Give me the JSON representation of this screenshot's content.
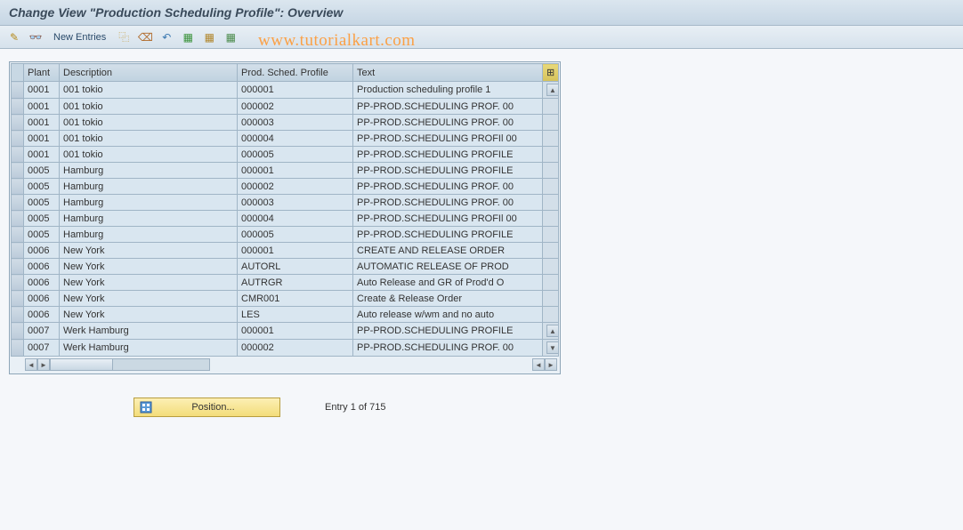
{
  "title": "Change View \"Production Scheduling Profile\": Overview",
  "watermark": "www.tutorialkart.com",
  "toolbar": {
    "new_entries_label": "New Entries"
  },
  "columns": {
    "plant": "Plant",
    "description": "Description",
    "profile": "Prod. Sched. Profile",
    "text": "Text"
  },
  "rows": [
    {
      "plant": "0001",
      "description": "001 tokio",
      "profile": "000001",
      "text": "Production scheduling profile 1"
    },
    {
      "plant": "0001",
      "description": "001 tokio",
      "profile": "000002",
      "text": "PP-PROD.SCHEDULING PROF. 00"
    },
    {
      "plant": "0001",
      "description": "001 tokio",
      "profile": "000003",
      "text": "PP-PROD.SCHEDULING PROF. 00"
    },
    {
      "plant": "0001",
      "description": "001 tokio",
      "profile": "000004",
      "text": "PP-PROD.SCHEDULING PROFIl 00"
    },
    {
      "plant": "0001",
      "description": "001 tokio",
      "profile": "000005",
      "text": "PP-PROD.SCHEDULING PROFILE"
    },
    {
      "plant": "0005",
      "description": "Hamburg",
      "profile": "000001",
      "text": "PP-PROD.SCHEDULING PROFILE"
    },
    {
      "plant": "0005",
      "description": "Hamburg",
      "profile": "000002",
      "text": "PP-PROD.SCHEDULING PROF. 00"
    },
    {
      "plant": "0005",
      "description": "Hamburg",
      "profile": "000003",
      "text": "PP-PROD.SCHEDULING PROF. 00"
    },
    {
      "plant": "0005",
      "description": "Hamburg",
      "profile": "000004",
      "text": "PP-PROD.SCHEDULING PROFIl 00"
    },
    {
      "plant": "0005",
      "description": "Hamburg",
      "profile": "000005",
      "text": "PP-PROD.SCHEDULING PROFILE"
    },
    {
      "plant": "0006",
      "description": "New York",
      "profile": "000001",
      "text": "CREATE AND RELEASE ORDER"
    },
    {
      "plant": "0006",
      "description": "New York",
      "profile": "AUTORL",
      "text": "AUTOMATIC RELEASE OF PROD"
    },
    {
      "plant": "0006",
      "description": "New York",
      "profile": "AUTRGR",
      "text": "Auto Release and GR of Prod'd O"
    },
    {
      "plant": "0006",
      "description": "New York",
      "profile": "CMR001",
      "text": "Create & Release Order"
    },
    {
      "plant": "0006",
      "description": "New York",
      "profile": "LES",
      "text": "Auto release w/wm and no auto"
    },
    {
      "plant": "0007",
      "description": "Werk Hamburg",
      "profile": "000001",
      "text": "PP-PROD.SCHEDULING PROFILE"
    },
    {
      "plant": "0007",
      "description": "Werk Hamburg",
      "profile": "000002",
      "text": "PP-PROD.SCHEDULING PROF. 00"
    }
  ],
  "footer": {
    "position_label": "Position...",
    "entry_status": "Entry 1 of 715"
  },
  "icons": {
    "config": "⊞"
  }
}
